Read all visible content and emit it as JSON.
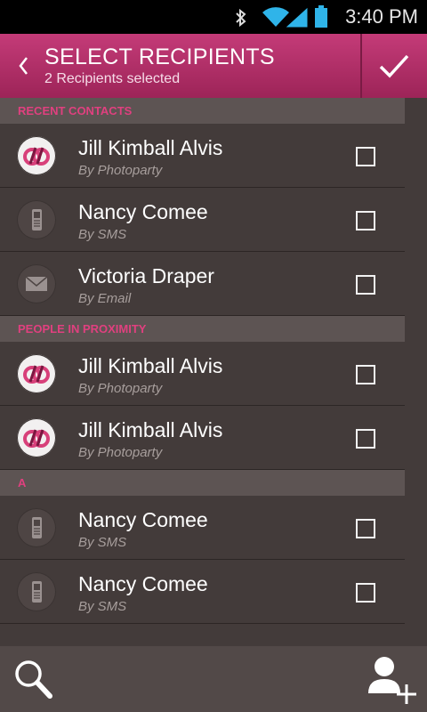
{
  "status_bar": {
    "time": "3:40 PM",
    "icons": [
      "bluetooth-icon",
      "wifi-icon",
      "cell-signal-icon",
      "battery-icon"
    ]
  },
  "app_bar": {
    "back_icon": "chevron-left-icon",
    "title": "SELECT RECIPIENTS",
    "subtitle": "2 Recipients selected",
    "confirm_icon": "checkmark-icon"
  },
  "colors": {
    "accent": "#e0407f",
    "appbar": "#b02c66",
    "background": "#433b3a"
  },
  "sections": [
    {
      "title": "RECENT CONTACTS",
      "rows": [
        {
          "name": "Jill Kimball Alvis",
          "method": "By Photoparty",
          "icon": "photoparty-icon",
          "checked": false
        },
        {
          "name": "Nancy Comee",
          "method": "By SMS",
          "icon": "phone-icon",
          "checked": false
        },
        {
          "name": "Victoria Draper",
          "method": "By Email",
          "icon": "envelope-icon",
          "checked": false
        }
      ]
    },
    {
      "title": "PEOPLE IN PROXIMITY",
      "rows": [
        {
          "name": "Jill Kimball Alvis",
          "method": "By Photoparty",
          "icon": "photoparty-icon",
          "checked": false
        },
        {
          "name": "Jill Kimball Alvis",
          "method": "By Photoparty",
          "icon": "photoparty-icon",
          "checked": false
        }
      ]
    },
    {
      "title": "A",
      "rows": [
        {
          "name": "Nancy Comee",
          "method": "By SMS",
          "icon": "phone-icon",
          "checked": false
        },
        {
          "name": "Nancy Comee",
          "method": "By SMS",
          "icon": "phone-icon",
          "checked": false
        }
      ]
    }
  ],
  "bottom_bar": {
    "search_icon": "search-icon",
    "add_contact_icon": "add-contact-icon"
  }
}
